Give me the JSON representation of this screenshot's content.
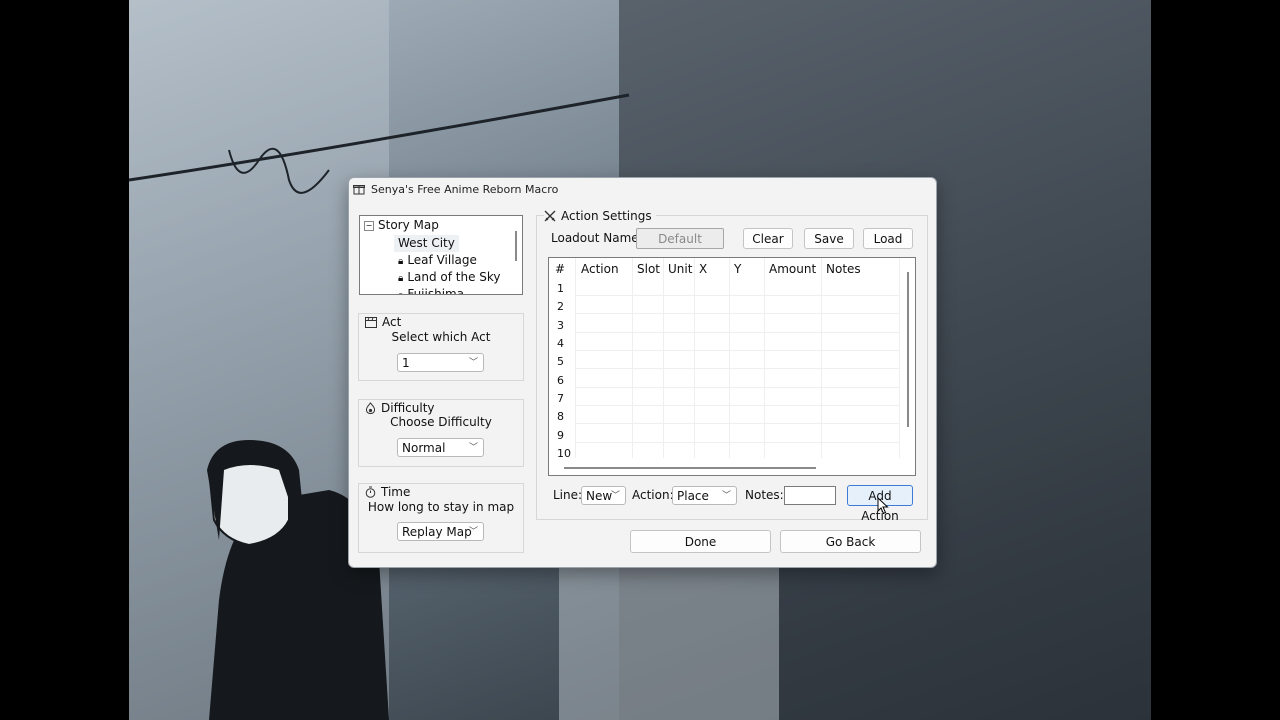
{
  "window": {
    "title": "Senya's Free Anime Reborn Macro"
  },
  "tree": {
    "root": "Story Map",
    "items": [
      "West City",
      "Leaf Village",
      "Land of the Sky",
      "Fujishima"
    ]
  },
  "act": {
    "heading": "Act",
    "label": "Select which Act",
    "value": "1"
  },
  "difficulty": {
    "heading": "Difficulty",
    "label": "Choose Difficulty",
    "value": "Normal"
  },
  "time": {
    "heading": "Time",
    "label": "How long to stay in map",
    "value": "Replay Map"
  },
  "action_settings": {
    "heading": "Action Settings",
    "loadout_label": "Loadout Name:",
    "loadout_value": "Default",
    "clear": "Clear",
    "save": "Save",
    "load": "Load"
  },
  "table": {
    "columns": [
      "#",
      "Action",
      "Slot",
      "Unit",
      "X",
      "Y",
      "Amount",
      "Notes"
    ],
    "rows": [
      "1",
      "2",
      "3",
      "4",
      "5",
      "6",
      "7",
      "8",
      "9",
      "10"
    ]
  },
  "controls": {
    "line_label": "Line:",
    "line_value": "New",
    "action_label": "Action:",
    "action_value": "Place",
    "notes_label": "Notes:",
    "notes_value": "",
    "add_action": "Add Action"
  },
  "footer": {
    "done": "Done",
    "go_back": "Go Back"
  }
}
